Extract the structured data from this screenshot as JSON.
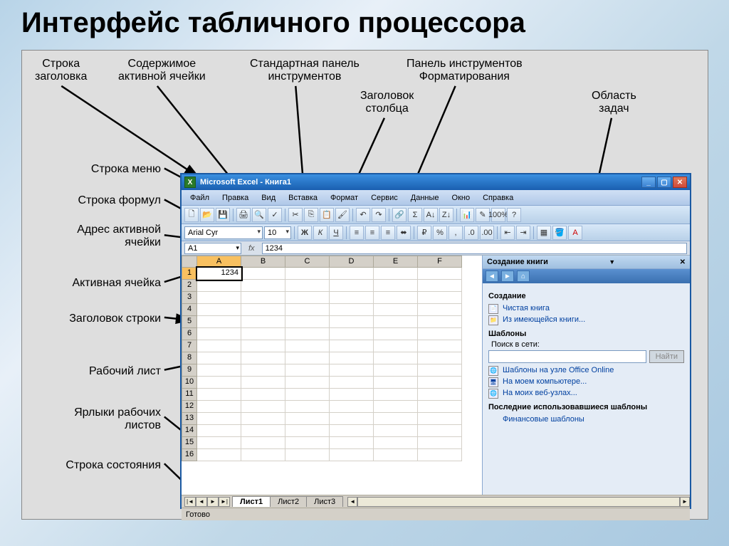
{
  "slide_title": "Интерфейс табличного процессора",
  "annotations": {
    "title_bar": "Строка\nзаголовка",
    "active_cell_content": "Содержимое\nактивной ячейки",
    "standard_toolbar": "Стандартная панель\nинструментов",
    "formatting_toolbar": "Панель инструментов\nФорматирования",
    "column_header": "Заголовок\nстолбца",
    "task_pane": "Область\nзадач",
    "menu_bar": "Строка меню",
    "formula_bar": "Строка формул",
    "active_cell_address": "Адрес активной\nячейки",
    "active_cell": "Активная ячейка",
    "row_header": "Заголовок строки",
    "worksheet": "Рабочий лист",
    "sheet_tabs": "Ярлыки рабочих\nлистов",
    "status_bar": "Строка состояния"
  },
  "window": {
    "title": "Microsoft Excel - Книга1"
  },
  "menu": [
    "Файл",
    "Правка",
    "Вид",
    "Вставка",
    "Формат",
    "Сервис",
    "Данные",
    "Окно",
    "Справка"
  ],
  "font_name": "Arial Cyr",
  "font_size": "10",
  "name_box": "A1",
  "formula_value": "1234",
  "columns": [
    "A",
    "B",
    "C",
    "D",
    "E",
    "F"
  ],
  "rows": [
    "1",
    "2",
    "3",
    "4",
    "5",
    "6",
    "7",
    "8",
    "9",
    "10",
    "11",
    "12",
    "13",
    "14",
    "15",
    "16"
  ],
  "cell_A1": "1234",
  "task_pane_title": "Создание книги",
  "tp_section_create": "Создание",
  "tp_blank": "Чистая книга",
  "tp_from_existing": "Из имеющейся книги...",
  "tp_section_templates": "Шаблоны",
  "tp_search_label": "Поиск в сети:",
  "tp_search_btn": "Найти",
  "tp_office_online": "Шаблоны на узле Office Online",
  "tp_on_computer": "На моем компьютере...",
  "tp_on_websites": "На моих веб-узлах...",
  "tp_section_recent": "Последние использовавшиеся шаблоны",
  "tp_financial": "Финансовые шаблоны",
  "sheets": [
    "Лист1",
    "Лист2",
    "Лист3"
  ],
  "status_text": "Готово"
}
